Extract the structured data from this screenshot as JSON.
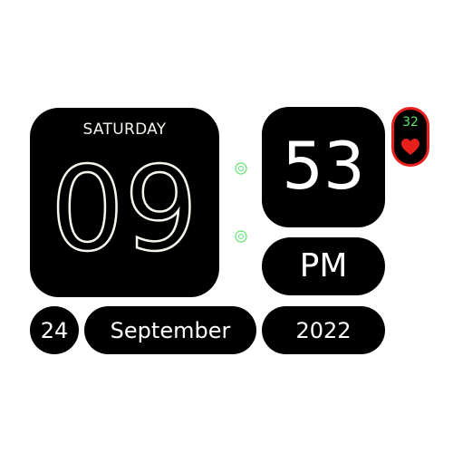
{
  "time": {
    "day_of_week": "SATURDAY",
    "hour": "09",
    "minute": "53",
    "meridiem": "PM"
  },
  "date": {
    "day": "24",
    "month": "September",
    "year": "2022"
  },
  "heart_rate": {
    "value": "32",
    "icon": "heart-icon"
  },
  "colors": {
    "tile_background": "#000000",
    "hour_outline": "#f6f6ee",
    "separator_green": "#5ee36b",
    "heart_red": "#e8201c"
  }
}
